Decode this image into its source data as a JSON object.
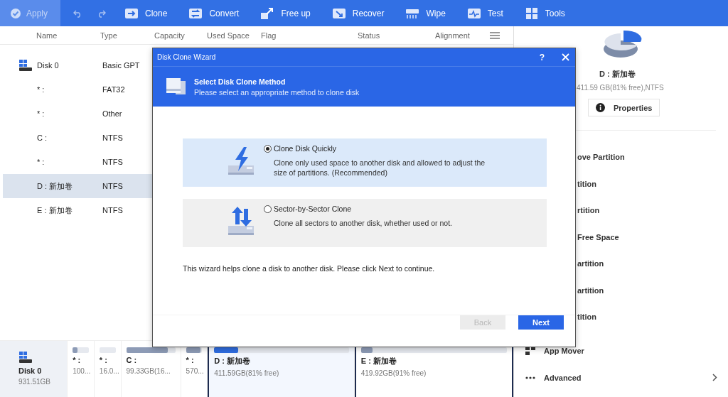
{
  "toolbar": {
    "apply": {
      "label": "Apply",
      "disabled": true
    },
    "items": [
      "Clone",
      "Convert",
      "Free up",
      "Recover",
      "Wipe",
      "Test",
      "Tools"
    ]
  },
  "table": {
    "columns": [
      "Name",
      "Type",
      "Capacity",
      "Used Space",
      "Flag",
      "Status",
      "Alignment"
    ],
    "rows": [
      {
        "kind": "disk",
        "name": "Disk 0",
        "type": "Basic GPT",
        "selected": false
      },
      {
        "kind": "partition",
        "name": "* :",
        "type": "FAT32",
        "selected": false
      },
      {
        "kind": "partition",
        "name": "* :",
        "type": "Other",
        "selected": false
      },
      {
        "kind": "partition",
        "name": "C :",
        "type": "NTFS",
        "selected": false
      },
      {
        "kind": "partition",
        "name": "* :",
        "type": "NTFS",
        "selected": false
      },
      {
        "kind": "partition",
        "name": "D : 新加卷",
        "type": "NTFS",
        "selected": true
      },
      {
        "kind": "partition",
        "name": "E : 新加卷",
        "type": "NTFS",
        "selected": false
      }
    ]
  },
  "disk_map": [
    {
      "kind": "disk",
      "name": "Disk 0",
      "info": "931.51GB",
      "selected": false
    },
    {
      "kind": "partition",
      "name": "* :",
      "info": "100...",
      "level": 0.3,
      "selected": false
    },
    {
      "kind": "partition",
      "name": "* :",
      "info": "16.0...",
      "selected": false
    },
    {
      "kind": "partition",
      "name": "C :",
      "info": "99.33GB(16...",
      "level": 0.85,
      "selected": false
    },
    {
      "kind": "partition",
      "name": "* :",
      "info": "570...",
      "level": 0.9,
      "selected": false
    },
    {
      "kind": "partition",
      "name": "D : 新加卷",
      "info": "411.59GB(81% free)",
      "level": 0.18,
      "selected": true
    },
    {
      "kind": "partition",
      "name": "E : 新加卷",
      "info": "419.92GB(91% free)",
      "level": 0.08,
      "selected": false
    }
  ],
  "right_panel": {
    "volume": "D : 新加卷",
    "details": "411.59 GB(81% free),NTFS",
    "properties_button": "Properties",
    "actions": [
      "ove Partition",
      "tition",
      "rtition",
      "Free Space",
      "artition",
      "artition",
      "tition"
    ],
    "menu": [
      {
        "label": "App Mover",
        "chevron": false
      },
      {
        "label": "Advanced",
        "chevron": true
      }
    ]
  },
  "dialog": {
    "title": "Disk Clone Wizard",
    "help": "?",
    "heading": "Select Disk Clone Method",
    "subheading": "Please select an appropriate method to clone disk",
    "options": [
      {
        "title": "Clone Disk Quickly",
        "description": "Clone only used space to another disk and allowed to adjust the size of partitions. (Recommended)",
        "selected": true
      },
      {
        "title": "Sector-by-Sector Clone",
        "description": "Clone all sectors to another disk, whether used or not.",
        "selected": false
      }
    ],
    "note": "This wizard helps clone a disk to another disk. Please click Next to continue.",
    "buttons": [
      {
        "label": "Back",
        "disabled": true
      },
      {
        "label": "Next",
        "disabled": false
      }
    ]
  }
}
